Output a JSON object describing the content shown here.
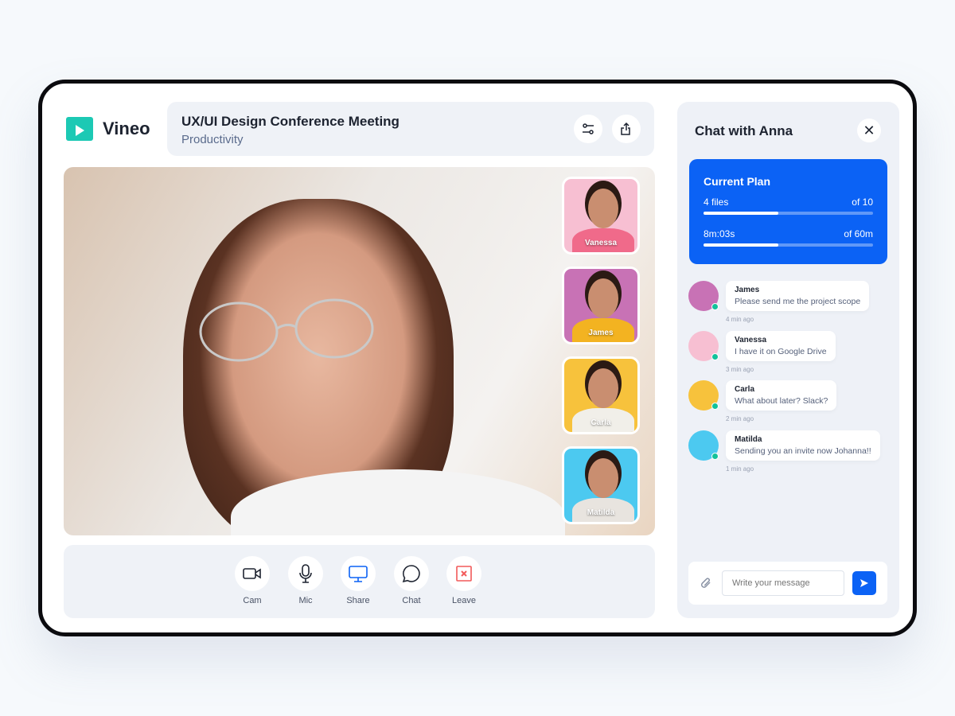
{
  "app": {
    "name": "Vineo"
  },
  "header": {
    "title": "UX/UI Design Conference Meeting",
    "subtitle": "Productivity"
  },
  "participants": [
    {
      "name": "Vanessa",
      "color": "#f7bfd2"
    },
    {
      "name": "James",
      "color": "#c872b5"
    },
    {
      "name": "Carla",
      "color": "#f7c23c"
    },
    {
      "name": "Matilda",
      "color": "#4cc9f0"
    }
  ],
  "controls": [
    {
      "label": "Cam"
    },
    {
      "label": "Mic"
    },
    {
      "label": "Share"
    },
    {
      "label": "Chat"
    },
    {
      "label": "Leave"
    }
  ],
  "chat": {
    "title": "Chat with Anna",
    "plan": {
      "title": "Current Plan",
      "files_label": "4 files",
      "files_max": "of 10",
      "files_fill": 0.44,
      "time_label": "8m:03s",
      "time_max": "of 60m",
      "time_fill": 0.44
    },
    "messages": [
      {
        "name": "James",
        "text": "Please send me the project scope",
        "ago": "4 min ago"
      },
      {
        "name": "Vanessa",
        "text": "I have it on Google Drive",
        "ago": "3 min ago"
      },
      {
        "name": "Carla",
        "text": "What about later? Slack?",
        "ago": "2 min ago"
      },
      {
        "name": "Matilda",
        "text": "Sending you an invite now Johanna!!",
        "ago": "1 min ago"
      }
    ],
    "placeholder": "Write your message"
  },
  "colors": {
    "accent": "#0b62f5",
    "brand": "#1cc9b4",
    "leave": "#f25a5a"
  }
}
